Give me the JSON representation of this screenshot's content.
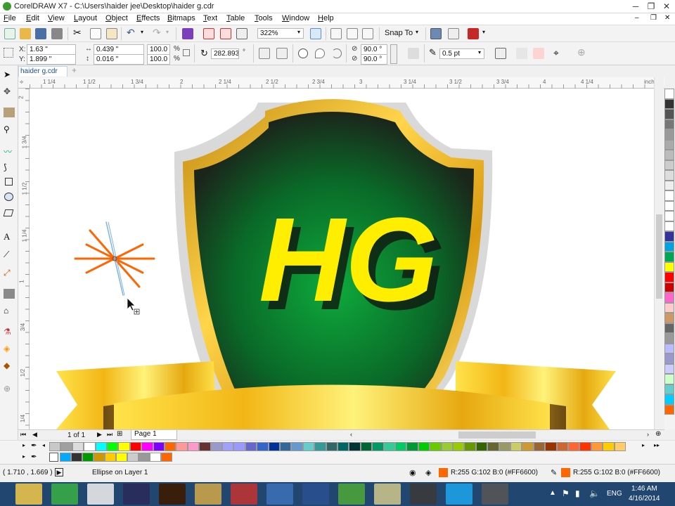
{
  "window": {
    "title": "CorelDRAW X7 - C:\\Users\\haider jee\\Desktop\\haider g.cdr",
    "minimize_glyph": "─",
    "restore_glyph": "❐",
    "close_glyph": "✕"
  },
  "menu": {
    "items": [
      "File",
      "Edit",
      "View",
      "Layout",
      "Object",
      "Effects",
      "Bitmaps",
      "Text",
      "Table",
      "Tools",
      "Window",
      "Help"
    ]
  },
  "toolbar_standard": {
    "zoom_value": "322%",
    "snap_to_label": "Snap To"
  },
  "property_bar": {
    "x_label": "X:",
    "x_value": "1.63 \"",
    "y_label": "Y:",
    "y_value": "1.899 \"",
    "width_value": "0.439 \"",
    "height_value": "0.016 \"",
    "scale_x": "100.0",
    "scale_y": "100.0",
    "percent": "%",
    "rotation_value": "282.893",
    "degree": "°",
    "start_angle": "90.0 °",
    "end_angle": "90.0 °",
    "outline_width": "0.5 pt"
  },
  "document": {
    "tab_label": "haider g.cdr",
    "add_tab_glyph": "+"
  },
  "ruler": {
    "top_ticks": [
      "1 1/4",
      "1 1/2",
      "1 3/4",
      "2",
      "2 1/4",
      "2 1/2",
      "2 3/4",
      "3",
      "3 1/4",
      "3 1/2",
      "3 3/4",
      "4",
      "4 1/4"
    ],
    "units": "inches",
    "left_ticks": [
      "2",
      "1 3/4",
      "1 1/2",
      "1 1/4",
      "1",
      "3/4",
      "1/2",
      "1/4"
    ]
  },
  "artwork": {
    "logo_text": "HG",
    "colors": {
      "gold": "#e9b020",
      "gold_light": "#ffe14a",
      "shield_green": "#0d8a2e",
      "shield_dark": "#1a2a1a",
      "letter_yellow": "#ffee00",
      "selected_orange": "#ff6600",
      "selection_blue": "#7fb3e0"
    }
  },
  "page_nav": {
    "page_counter": "1 of 1",
    "page_tab": "Page 1"
  },
  "palette": {
    "row1": [
      "#c8c8c8",
      "#a0a0a0",
      "#dcdcdc",
      "#ffffff",
      "#00ffff",
      "#00ff00",
      "#ffff00",
      "#ff0000",
      "#ff00ff",
      "#8000ff",
      "#ff6600",
      "#ff9999",
      "#ff99cc",
      "#663333",
      "#9999cc",
      "#a0a0ff",
      "#9999ff",
      "#6666cc",
      "#3366cc",
      "#003399",
      "#336699",
      "#6699cc",
      "#66cccc",
      "#339999",
      "#336666",
      "#006666",
      "#003333",
      "#006633",
      "#009966",
      "#33cc99",
      "#00cc66",
      "#009933",
      "#00cc00",
      "#66cc00",
      "#99cc33",
      "#99cc00",
      "#669900",
      "#336600",
      "#666633",
      "#999966",
      "#cccc66",
      "#cc9933",
      "#996633",
      "#993300",
      "#cc6633",
      "#ff6633",
      "#ff3300",
      "#ff9933",
      "#ffcc00",
      "#ffcc66"
    ],
    "row2": [
      "#00aaff",
      "#333333",
      "#009900",
      "#cc9900",
      "#ffcc00",
      "#ffff00",
      "#cccccc",
      "#999999",
      "#ffffff",
      "#ff6600"
    ],
    "right": [
      "#ffffff",
      "#333333",
      "#555555",
      "#777777",
      "#999999",
      "#aaaaaa",
      "#bbbbbb",
      "#cccccc",
      "#dddddd",
      "#eeeeee",
      "#ffffff",
      "#ffffff",
      "#ffffff",
      "#ffffff",
      "#333399",
      "#00a3e0",
      "#00a651",
      "#ffff00",
      "#ff0000",
      "#cc0000",
      "#ff66cc",
      "#ffcccc",
      "#cc9966",
      "#666666",
      "#999999",
      "#bbbbff",
      "#9999cc",
      "#ccccff",
      "#ccffcc",
      "#66cccc",
      "#00ccff",
      "#ff6600"
    ]
  },
  "status": {
    "coords": "( 1.710 , 1.669 )",
    "object_info": "Ellipse on Layer 1",
    "fill_info": "R:255 G:102 B:0 (#FF6600)",
    "outline_info": "R:255 G:102 B:0 (#FF6600)"
  },
  "taskbar": {
    "lang": "ENG",
    "time": "1:46 AM",
    "date": "4/16/2014",
    "apps": [
      "explorer-icon",
      "coreldraw-icon",
      "chrome-icon",
      "media-player-icon",
      "illustrator-icon",
      "d-app-icon",
      "inpage-icon",
      "pen-app-icon",
      "k-2010-icon",
      "utorrent-icon",
      "envelope-app-icon",
      "camera-recorder-icon",
      "skype-icon",
      "screen-capture-icon"
    ]
  }
}
